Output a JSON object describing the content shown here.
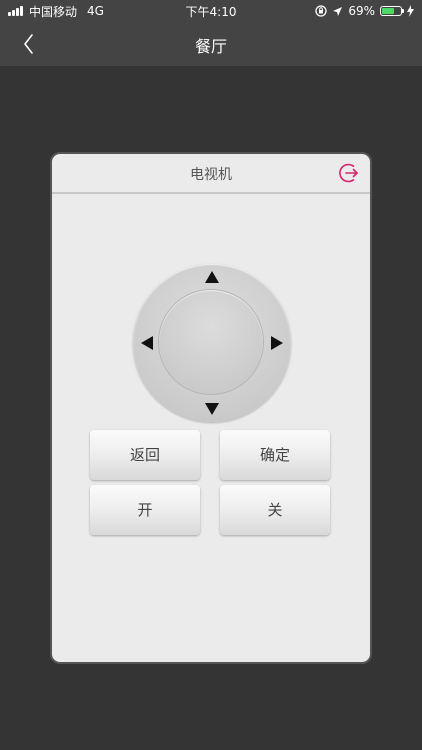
{
  "status_bar": {
    "carrier": "中国移动",
    "network": "4G",
    "time": "下午4:10",
    "battery": "69%",
    "battery_level": 0.69,
    "icons": [
      "signal-icon",
      "orientation-lock-icon",
      "location-arrow-icon",
      "battery-icon",
      "charging-bolt-icon"
    ]
  },
  "nav": {
    "title": "餐厅",
    "back_icon": "chevron-left-icon"
  },
  "remote": {
    "title": "电视机",
    "exit_icon": "exit-icon",
    "dpad_icons": [
      "arrow-up-icon",
      "arrow-down-icon",
      "arrow-left-icon",
      "arrow-right-icon"
    ],
    "buttons": {
      "back": "返回",
      "ok": "确定",
      "on": "开",
      "off": "关"
    }
  },
  "colors": {
    "accent": "#d6246e",
    "background": "#343434",
    "header": "#444444",
    "panel": "#ebebeb",
    "battery_fill": "#4cd964"
  }
}
